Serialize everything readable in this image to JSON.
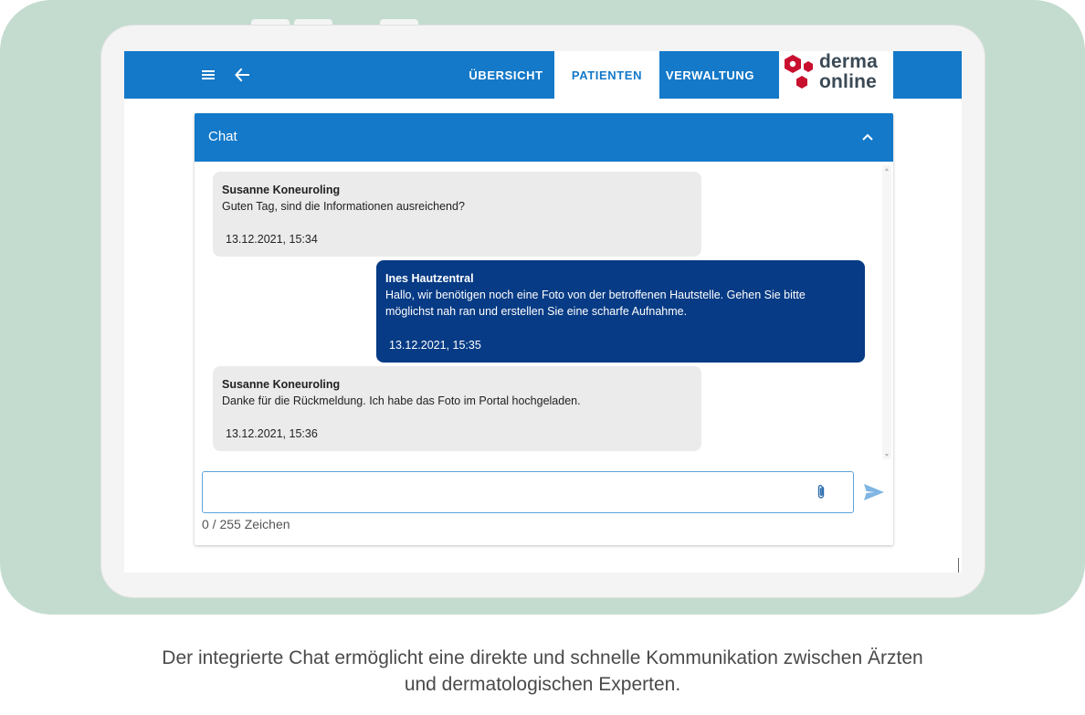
{
  "appbar": {
    "menu_icon": "hamburger-menu-icon",
    "back_icon": "arrow-left-icon",
    "nav": [
      "ÜBERSICHT",
      "PATIENTEN",
      "VERWALTUNG"
    ],
    "active_nav": "PATIENTEN",
    "logo": {
      "line1": "derma",
      "line2": "online",
      "mark_color": "#c8102e"
    }
  },
  "chat": {
    "title": "Chat",
    "collapse_icon": "chevron-up-icon",
    "messages": [
      {
        "direction": "incoming",
        "sender": "Susanne Koneuroling",
        "lines": [
          "Guten Tag, sind die Informationen ausreichend?"
        ],
        "timestamp": "13.12.2021, 15:34"
      },
      {
        "direction": "outgoing",
        "sender": "Ines Hautzentral",
        "lines": [
          "Hallo, wir benötigen noch eine Foto von der betroffenen Hautstelle. Gehen Sie bitte",
          "möglichst nah ran und erstellen Sie eine scharfe Aufnahme."
        ],
        "timestamp": "13.12.2021, 15:35"
      },
      {
        "direction": "incoming",
        "sender": "Susanne Koneuroling",
        "lines": [
          "Danke für die Rückmeldung. Ich habe das Foto im Portal hochgeladen."
        ],
        "timestamp": "13.12.2021, 15:36"
      }
    ],
    "input_value": "",
    "attach_icon": "paperclip-icon",
    "send_icon": "send-icon",
    "char_counter": "0 / 255 Zeichen"
  },
  "caption": {
    "line1": "Der integrierte Chat ermöglicht eine direkte und schnelle Kommunikation zwischen Ärzten",
    "line2": "und dermatologischen Experten."
  },
  "colors": {
    "primary": "#1479c9",
    "outgoing_bubble": "#073b85",
    "incoming_bubble": "#ebebeb",
    "background": "#c3dccf"
  }
}
